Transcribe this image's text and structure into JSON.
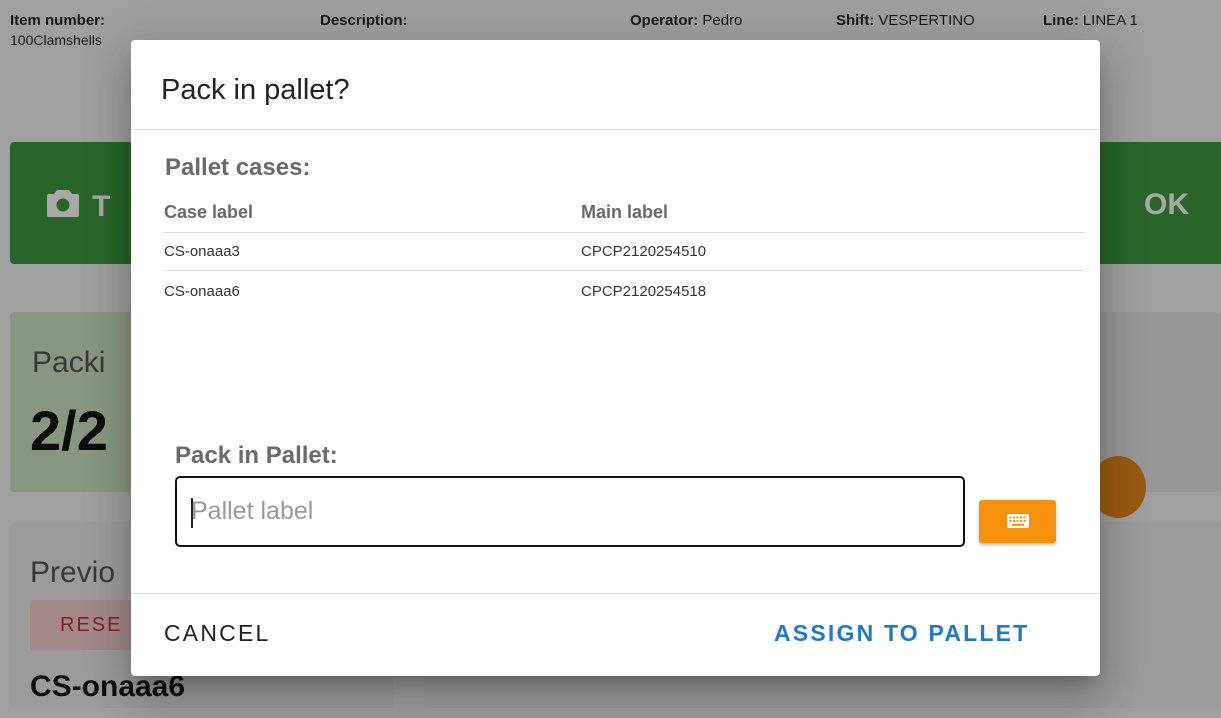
{
  "header": {
    "item_number_label": "Item number:",
    "item_number_value": "100Clamshells",
    "description_label": "Description:",
    "operator_label": "Operator:",
    "operator_value": "Pedro",
    "shift_label": "Shift:",
    "shift_value": "VESPERTINO",
    "line_label": "Line:",
    "line_value": "LINEA 1"
  },
  "background": {
    "camera_button_partial": "T",
    "ok_button": "OK",
    "packing_title_partial": "Packi",
    "packing_count_partial": "2/2",
    "previous_title_partial": "Previo",
    "reset_button_partial": "RESE",
    "previous_case": "CS-onaaa6",
    "colors": {
      "green": "#3f9a3e",
      "orange": "#e8891a"
    },
    "icons": {
      "camera": "camera-icon"
    }
  },
  "dialog": {
    "title": "Pack in pallet?",
    "section_title": "Pallet cases:",
    "table": {
      "columns": [
        "Case label",
        "Main label"
      ],
      "rows": [
        {
          "case_label": "CS-onaaa3",
          "main_label": "CPCP2120254510"
        },
        {
          "case_label": "CS-onaaa6",
          "main_label": "CPCP2120254518"
        }
      ]
    },
    "pack_label": "Pack in Pallet:",
    "pallet_input": {
      "value": "",
      "placeholder": "Pallet label"
    },
    "keyboard_button": {
      "icon": "keyboard-icon",
      "color": "#f5900d"
    },
    "cancel_label": "CANCEL",
    "assign_label": "ASSIGN TO PALLET",
    "accent_color": "#1e78d4"
  }
}
